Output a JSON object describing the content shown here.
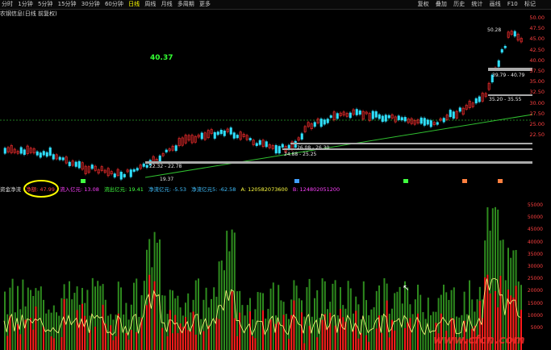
{
  "toolbar": {
    "periods": [
      "分时",
      "1分钟",
      "5分钟",
      "15分钟",
      "30分钟",
      "60分钟",
      "日线",
      "周线",
      "月线",
      "多周期",
      "更多"
    ],
    "active": "日线",
    "right": [
      "复权",
      "叠加",
      "历史",
      "统计",
      "画线",
      "F10",
      "标记"
    ]
  },
  "subtitle": "农钢信息(日线 前复权)",
  "price_label": "40.37",
  "y_ticks": [
    "50.00",
    "47.50",
    "45.00",
    "42.50",
    "40.00",
    "37.50",
    "35.00",
    "32.50",
    "30.00",
    "27.50",
    "25.00",
    "22.50"
  ],
  "boxes": [
    "39.79 - 40.79",
    "35.20 - 35.55",
    "26.08 - 26.30",
    "24.88 - 25.25",
    "22.32 - 22.78",
    "19.37",
    "50.28"
  ],
  "indicator": {
    "name": "资金净流",
    "items": [
      "净额: 47.99",
      "流入亿元: 13.08",
      "流出亿元: 19.41",
      "净流亿元: -5.53",
      "净流亿元5: -62.58",
      "A: 120582073600",
      "B: 124802051200"
    ]
  },
  "y2_ticks": [
    "55000",
    "50000",
    "45000",
    "40000",
    "35000",
    "30000",
    "25000",
    "20000",
    "15000",
    "10000",
    "5000"
  ],
  "watermark": "www.cfcn.com"
}
